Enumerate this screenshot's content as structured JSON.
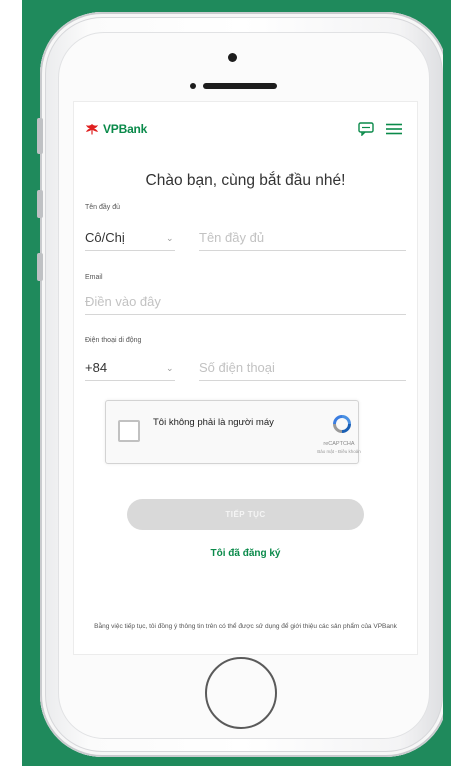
{
  "brand": {
    "name": "VPBank",
    "color": "#0a8a4a",
    "logo_color": "#e02020"
  },
  "header": {
    "chat_icon": "chat-bubble-icon",
    "menu_icon": "hamburger-menu-icon"
  },
  "form": {
    "title": "Chào bạn, cùng bắt đầu nhé!",
    "fullname": {
      "label": "Tên đầy đủ",
      "salutation_value": "Cô/Chị",
      "placeholder": "Tên đầy đủ"
    },
    "email": {
      "label": "Email",
      "placeholder": "Điền vào đây"
    },
    "phone": {
      "label": "Điện thoại di động",
      "country_code": "+84",
      "placeholder": "Số điện thoại"
    },
    "captcha": {
      "label": "Tôi không phải là người máy",
      "brand": "reCAPTCHA",
      "terms": "Bảo mật - Điều khoản"
    },
    "continue_button": "TIẾP TỤC",
    "registered_link": "Tôi đã đăng ký",
    "disclaimer": "Bằng việc tiếp tục, tôi đồng ý thông tin trên có thể được sử dụng để giới thiệu các sản phẩm của VPBank"
  },
  "colors": {
    "background": "#1f8a5c",
    "button_disabled": "#d9d9d9",
    "link": "#0a8a4a"
  }
}
